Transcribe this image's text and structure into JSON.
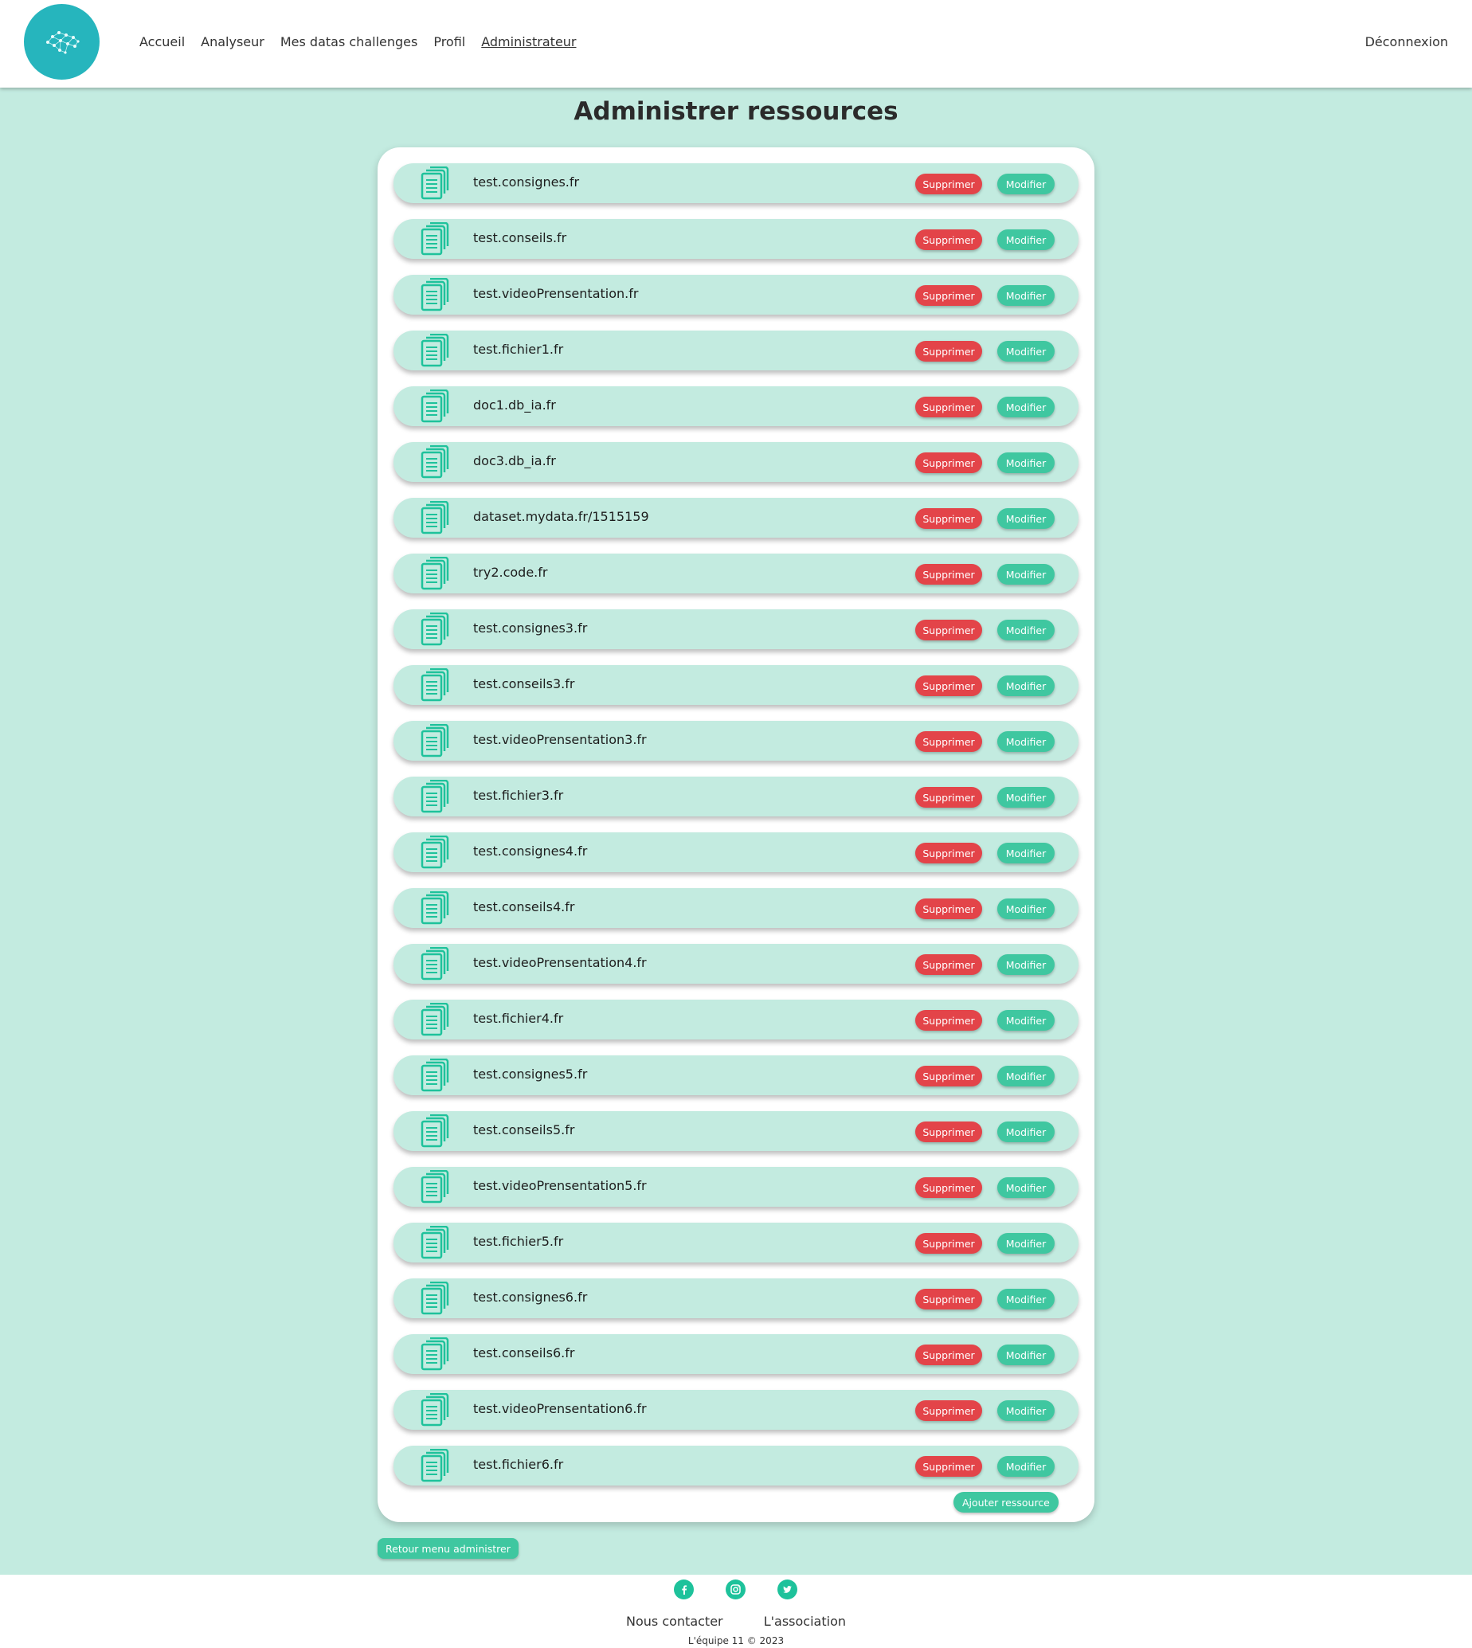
{
  "header": {
    "nav": [
      "Accueil",
      "Analyseur",
      "Mes datas challenges",
      "Profil",
      "Administrateur"
    ],
    "active_nav": "Administrateur",
    "logout": "Déconnexion"
  },
  "page": {
    "title": "Administrer ressources"
  },
  "resources": [
    "test.consignes.fr",
    "test.conseils.fr",
    "test.videoPrensentation.fr",
    "test.fichier1.fr",
    "doc1.db_ia.fr",
    "doc3.db_ia.fr",
    "dataset.mydata.fr/1515159",
    "try2.code.fr",
    "test.consignes3.fr",
    "test.conseils3.fr",
    "test.videoPrensentation3.fr",
    "test.fichier3.fr",
    "test.consignes4.fr",
    "test.conseils4.fr",
    "test.videoPrensentation4.fr",
    "test.fichier4.fr",
    "test.consignes5.fr",
    "test.conseils5.fr",
    "test.videoPrensentation5.fr",
    "test.fichier5.fr",
    "test.consignes6.fr",
    "test.conseils6.fr",
    "test.videoPrensentation6.fr",
    "test.fichier6.fr"
  ],
  "buttons": {
    "delete": "Supprimer",
    "modify": "Modifier",
    "add": "Ajouter ressource",
    "back": "Retour menu administrer"
  },
  "footer": {
    "social": [
      "facebook-icon",
      "instagram-icon",
      "twitter-icon"
    ],
    "links": [
      "Nous contacter",
      "L'association"
    ],
    "copyright": "L'équipe 11 © 2023"
  },
  "colors": {
    "background": "#c3ebe0",
    "delete": "#e34449",
    "modify": "#3fc7a0",
    "logo": "#26b5bd",
    "icon": "#1ec29b"
  }
}
